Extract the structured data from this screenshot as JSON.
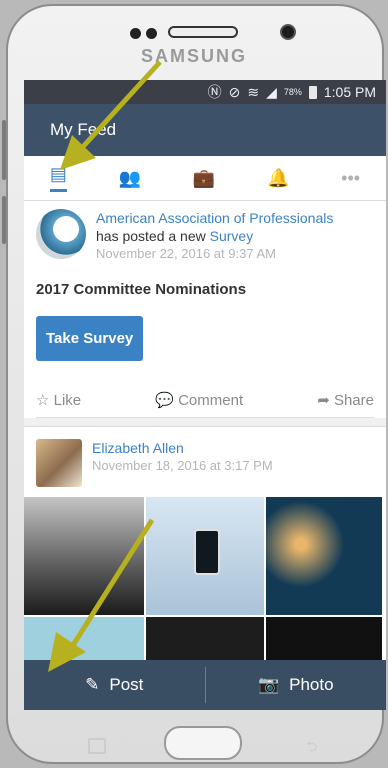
{
  "device": {
    "brand": "SAMSUNG"
  },
  "status_bar": {
    "battery": "78%",
    "time": "1:05 PM"
  },
  "app_bar": {
    "title": "My Feed"
  },
  "tabs": [
    {
      "icon": "feed-icon",
      "active": true
    },
    {
      "icon": "people-icon",
      "active": false
    },
    {
      "icon": "briefcase-icon",
      "active": false
    },
    {
      "icon": "bell-icon",
      "active": false
    },
    {
      "icon": "more-icon",
      "active": false
    }
  ],
  "post1": {
    "org": "American Association of Professionals",
    "action_text": "has posted a new",
    "action_link": "Survey",
    "timestamp": "November 22, 2016 at 9:37 AM",
    "title": "2017 Committee Nominations",
    "button": "Take Survey",
    "like": "Like",
    "comment": "Comment",
    "share": "Share"
  },
  "post2": {
    "author": "Elizabeth Allen",
    "timestamp": "November 18, 2016 at 3:17 PM"
  },
  "bottom_bar": {
    "post": "Post",
    "photo": "Photo"
  },
  "colors": {
    "accent": "#3b82c4",
    "appbar": "#3d5269",
    "arrow": "#b7b01f"
  }
}
